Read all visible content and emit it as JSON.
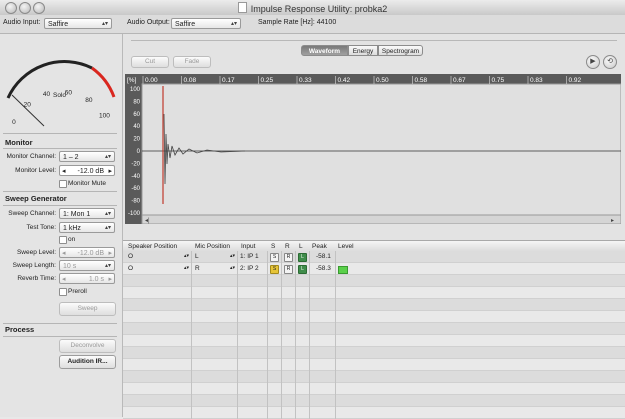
{
  "window": {
    "title": "Impulse Response Utility: probka2"
  },
  "topbar": {
    "audio_input_label": "Audio Input:",
    "audio_input_value": "Saffire",
    "audio_output_label": "Audio Output:",
    "audio_output_value": "Saffire",
    "sample_rate": "Sample Rate [Hz]: 44100"
  },
  "meter": {
    "ticks": [
      "0",
      "20",
      "40",
      "60",
      "80",
      "100"
    ],
    "label": "Solo"
  },
  "monitor": {
    "title": "Monitor",
    "channel_label": "Monitor Channel:",
    "channel_value": "1 – 2",
    "level_label": "Monitor  Level:",
    "level_value": "-12.0 dB",
    "mute_label": "Monitor Mute"
  },
  "sweep": {
    "title": "Sweep Generator",
    "channel_label": "Sweep Channel:",
    "channel_value": "1: Mon 1",
    "tone_label": "Test Tone:",
    "tone_value": "1 kHz",
    "on_label": "on",
    "level_label": "Sweep Level:",
    "level_value": "-12.0 dB",
    "length_label": "Sweep Length:",
    "length_value": "10 s",
    "reverb_label": "Reverb Time:",
    "reverb_value": "1.0 s",
    "preroll_label": "Preroll",
    "sweep_button": "Sweep"
  },
  "process": {
    "title": "Process",
    "deconvolve_button": "Deconvolve",
    "audition_button": "Audition IR..."
  },
  "editor": {
    "cut": "Cut",
    "fade": "Fade",
    "tabs": [
      "Waveform",
      "Energy",
      "Spectrogram"
    ],
    "selected_tab": "Waveform",
    "play_icon": "play-icon",
    "loop_icon": "loop-icon",
    "unit": "[%]",
    "time_ticks": [
      "0.00",
      "0.08",
      "0.17",
      "0.25",
      "0.33",
      "0.42",
      "0.50",
      "0.58",
      "0.67",
      "0.75",
      "0.83",
      "0.92"
    ],
    "amp_ticks": [
      "100",
      "80",
      "60",
      "40",
      "20",
      "0",
      "-20",
      "-40",
      "-60",
      "-80",
      "-100"
    ]
  },
  "table": {
    "headers": [
      "Speaker Position",
      "Mic Position",
      "Input",
      "S",
      "R",
      "L",
      "Peak",
      "Level"
    ],
    "rows": [
      {
        "speaker": "O",
        "mic": "L",
        "input": "1: IP 1",
        "s": "S",
        "r": "R",
        "l": "L",
        "peak": "-58.1",
        "level": 0
      },
      {
        "speaker": "O",
        "mic": "R",
        "input": "2: IP 2",
        "s": "S",
        "r": "R",
        "l": "L",
        "peak": "-58.3",
        "level": 0.45
      }
    ],
    "colors": {
      "solo_active": "#e6c437",
      "lock_active": "#3f8c4a",
      "level_meter": "#5ad04a",
      "impulse": "#c0392b"
    }
  }
}
